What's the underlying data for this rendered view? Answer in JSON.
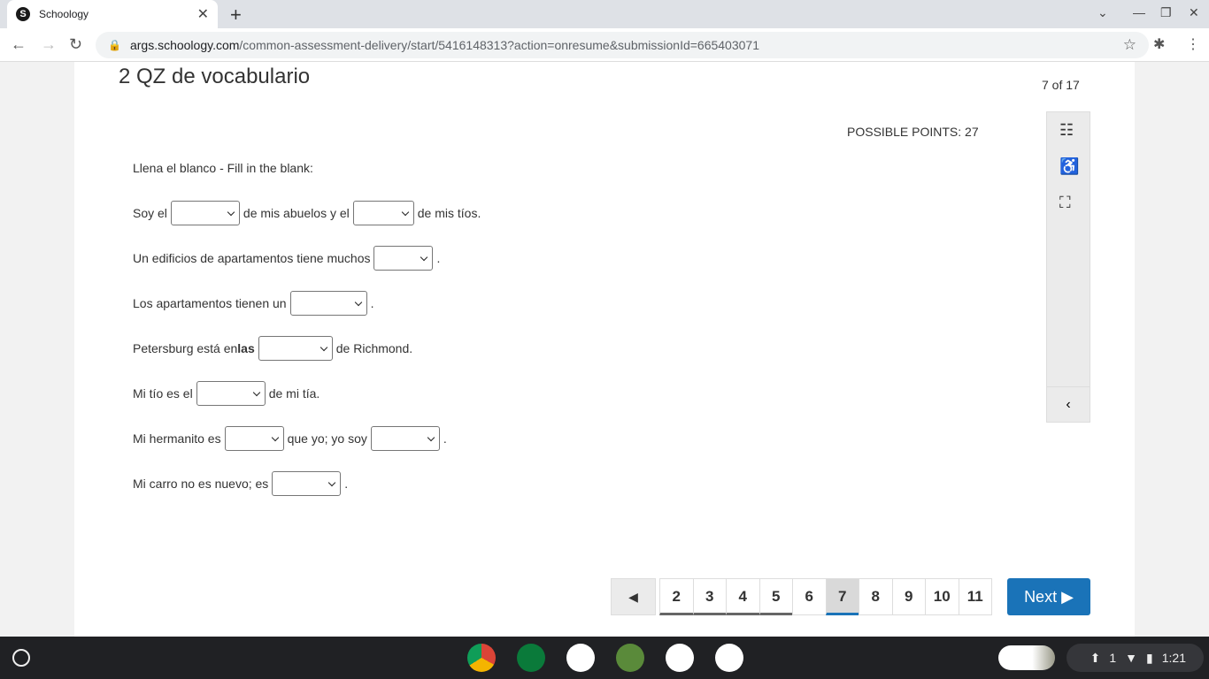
{
  "browser": {
    "tab_title": "Schoology",
    "url_host": "args.schoology.com",
    "url_path": "/common-assessment-delivery/start/5416148313?action=onresume&submissionId=665403071"
  },
  "quiz": {
    "title": "2 QZ de vocabulario",
    "question_count": "7 of 17",
    "possible_points": "POSSIBLE POINTS: 27",
    "instructions": "Llena el blanco - Fill in the blank:",
    "sentences": [
      [
        {
          "t": "Soy el"
        },
        {
          "s": 78
        },
        {
          "t": "de mis abuelos y el"
        },
        {
          "s": 69
        },
        {
          "t": "de mis tíos."
        }
      ],
      [
        {
          "t": "Un edificios de apartamentos tiene muchos"
        },
        {
          "s": 67
        },
        {
          "t": "."
        }
      ],
      [
        {
          "t": "Los apartamentos tienen un"
        },
        {
          "s": 87
        },
        {
          "t": "."
        }
      ],
      [
        {
          "t": "Petersburg está en "
        },
        {
          "b": "las"
        },
        {
          "s": 84
        },
        {
          "t": "de Richmond."
        }
      ],
      [
        {
          "t": "Mi tío es el"
        },
        {
          "s": 78
        },
        {
          "t": "de mi tía."
        }
      ],
      [
        {
          "t": "Mi hermanito es"
        },
        {
          "s": 67
        },
        {
          "t": "que yo; yo soy"
        },
        {
          "s": 78
        },
        {
          "t": "."
        }
      ],
      [
        {
          "t": "Mi carro no es nuevo; es"
        },
        {
          "s": 78
        },
        {
          "t": "."
        }
      ]
    ]
  },
  "pager": {
    "pages": [
      {
        "n": "2",
        "state": "answered"
      },
      {
        "n": "3",
        "state": "answered"
      },
      {
        "n": "4",
        "state": "answered"
      },
      {
        "n": "5",
        "state": "answered"
      },
      {
        "n": "6",
        "state": ""
      },
      {
        "n": "7",
        "state": "current"
      },
      {
        "n": "8",
        "state": ""
      },
      {
        "n": "9",
        "state": ""
      },
      {
        "n": "10",
        "state": ""
      },
      {
        "n": "11",
        "state": ""
      }
    ],
    "next_label": "Next"
  },
  "taskbar": {
    "time": "1:21",
    "notifications": "1"
  },
  "colors": {
    "accent": "#1a73b8"
  }
}
